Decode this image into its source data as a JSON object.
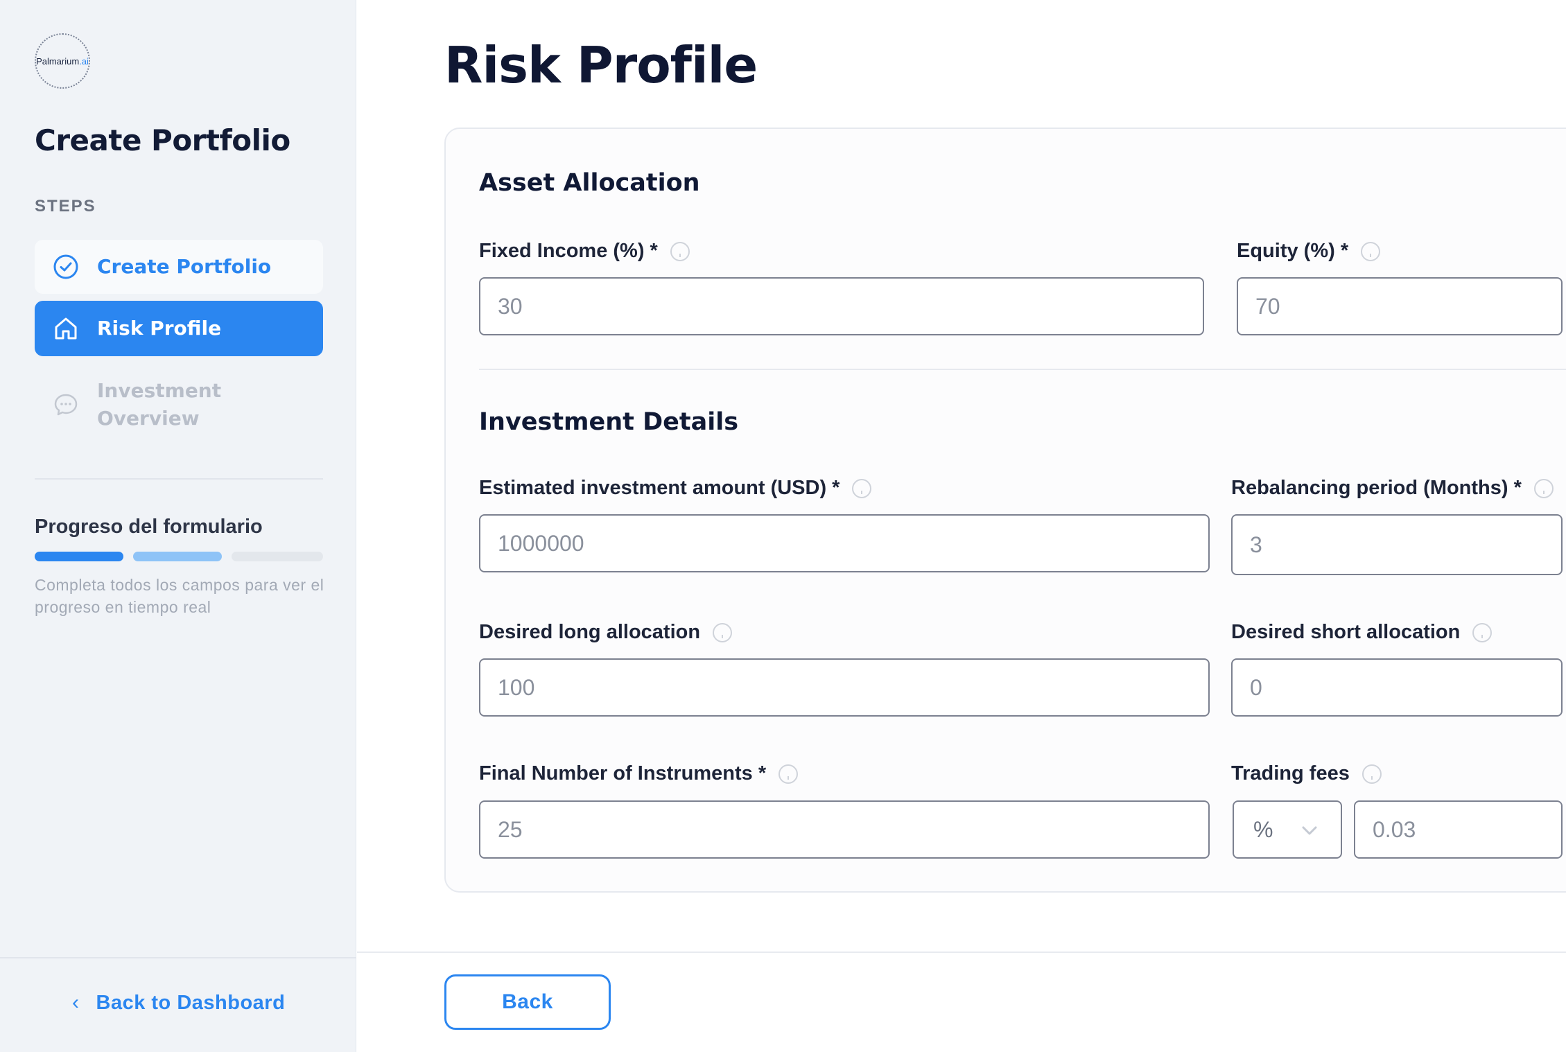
{
  "brand": {
    "logo_text": "Palmarium",
    "logo_suffix": ".ai"
  },
  "sidebar": {
    "title": "Create Portfolio",
    "steps_label": "STEPS",
    "steps": [
      {
        "label": "Create Portfolio",
        "state": "completed",
        "icon": "check-circle-icon"
      },
      {
        "label": "Risk Profile",
        "state": "active",
        "icon": "home-icon"
      },
      {
        "label": "Investment Overview",
        "state": "pending",
        "icon": "chat-bubble-icon"
      }
    ],
    "progress": {
      "title": "Progreso del formulario",
      "segments": [
        "complete",
        "partial",
        "empty"
      ],
      "hint": "Completa todos los campos para ver el progreso en tiempo real"
    },
    "back_link": "Back to Dashboard"
  },
  "page": {
    "title": "Risk Profile"
  },
  "asset_allocation": {
    "title": "Asset Allocation",
    "fixed_income": {
      "label": "Fixed Income (%) *",
      "placeholder": "30"
    },
    "equity": {
      "label": "Equity (%) *",
      "placeholder": "70"
    }
  },
  "investment_details": {
    "title": "Investment Details",
    "amount": {
      "label": "Estimated investment amount (USD) *",
      "placeholder": "1000000"
    },
    "rebalancing": {
      "label": "Rebalancing period (Months) *",
      "placeholder": "3"
    },
    "long_alloc": {
      "label": "Desired long allocation",
      "placeholder": "100"
    },
    "short_alloc": {
      "label": "Desired short allocation",
      "placeholder": "0"
    },
    "instruments": {
      "label": "Final Number of Instruments *",
      "placeholder": "25"
    },
    "fees": {
      "label": "Trading fees",
      "unit": "%",
      "placeholder": "0.03"
    }
  },
  "footer": {
    "back_label": "Back"
  },
  "colors": {
    "accent": "#2b86f0",
    "title": "#0f1733",
    "sidebar_bg": "#f0f3f7"
  }
}
